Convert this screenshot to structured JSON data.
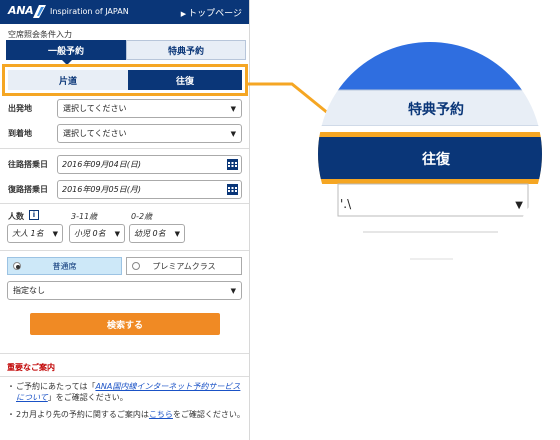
{
  "header": {
    "logo_text": "ANA",
    "tagline": "Inspiration of JAPAN",
    "top_link": "トップページ"
  },
  "form": {
    "section_title": "空席照会条件入力",
    "tabs": {
      "general": "一般予約",
      "award": "特典予約"
    },
    "trip": {
      "one_way": "片道",
      "round_trip": "往復"
    },
    "departure": {
      "label": "出発地",
      "value": "選択してください"
    },
    "arrival": {
      "label": "到着地",
      "value": "選択してください"
    },
    "outbound": {
      "label": "往路搭乗日",
      "value": "2016年09月04日(日)"
    },
    "return": {
      "label": "復路搭乗日",
      "value": "2016年09月05日(月)"
    },
    "passengers": {
      "label": "人数",
      "info": "i",
      "child_age": "3-11歳",
      "infant_age": "0-2歳",
      "adult": "大人 1名",
      "child": "小児 0名",
      "infant": "幼児 0名"
    },
    "cabin": {
      "economy": "普通席",
      "premium": "プレミアムクラス"
    },
    "preference": {
      "value": "指定なし"
    },
    "search_button": "検索する"
  },
  "notice": {
    "title": "重要なご案内",
    "item1_pre": "ご予約にあたっては「",
    "item1_link": "ANA国内線インターネット予約サービスについて",
    "item1_post": "」をご確認ください。",
    "item2_pre": "2カ月より先の予約に関するご案内は",
    "item2_link": "こちら",
    "item2_post": "をご確認ください。"
  },
  "zoom": {
    "award_tab": "特典予約",
    "round_trip": "往復",
    "partial_text": "'.\\"
  },
  "colors": {
    "ana_navy": "#0a3678",
    "tab_light": "#e8eef6",
    "highlight_orange": "#f5a623",
    "search_orange": "#f08a24",
    "economy_blue": "#cde8f8",
    "zoom_blue": "#2f6ee0",
    "notice_red": "#c00000",
    "link_blue": "#1a52c6"
  },
  "icons": {
    "dropdown": "chevron-down-icon",
    "calendar": "calendar-icon",
    "top_link": "triangle-right-icon",
    "info": "info-icon"
  }
}
